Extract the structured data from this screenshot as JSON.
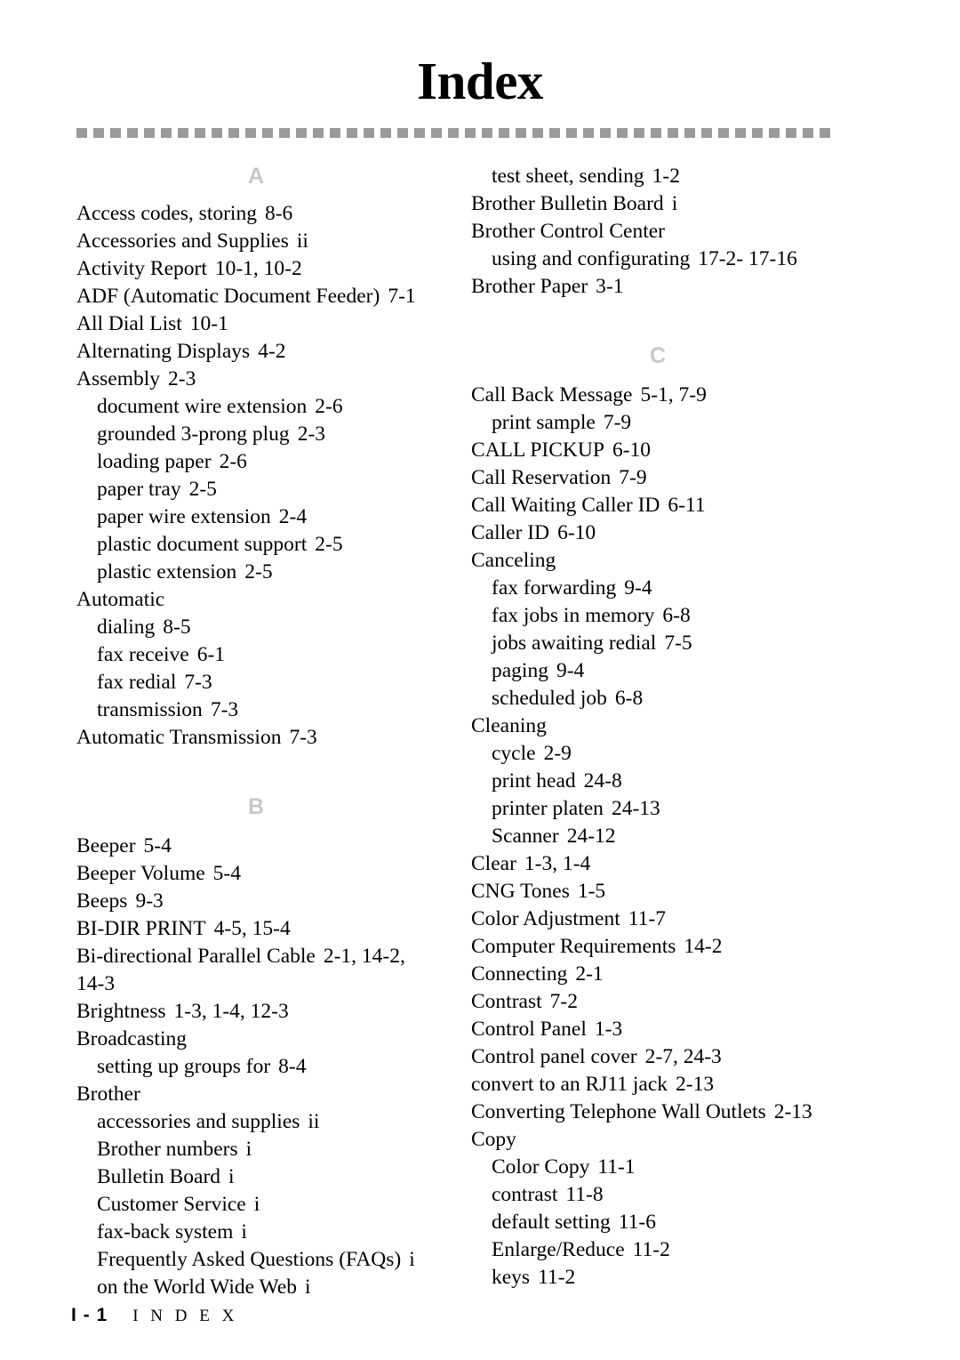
{
  "page": {
    "title": "Index",
    "footer_folio": "I - 1",
    "footer_label": "I N D E X",
    "rule_color": "#9a9a9a",
    "section_letter_color": "#c8c8c8"
  },
  "left_column": {
    "sections": [
      {
        "letter": "A",
        "entries": [
          {
            "term": "Access codes, storing",
            "refs": "8-6",
            "sub": false
          },
          {
            "term": "Accessories and Supplies",
            "refs": "ii",
            "sub": false
          },
          {
            "term": "Activity Report",
            "refs": "10-1,  10-2",
            "sub": false
          },
          {
            "term": "ADF (Automatic Document Feeder)",
            "refs": "7-1",
            "sub": false
          },
          {
            "term": "All Dial List",
            "refs": "10-1",
            "sub": false
          },
          {
            "term": "Alternating Displays",
            "refs": "4-2",
            "sub": false
          },
          {
            "term": "Assembly",
            "refs": "2-3",
            "sub": false
          },
          {
            "term": "document wire extension",
            "refs": "2-6",
            "sub": true
          },
          {
            "term": "grounded 3-prong plug",
            "refs": "2-3",
            "sub": true
          },
          {
            "term": "loading paper",
            "refs": "2-6",
            "sub": true
          },
          {
            "term": "paper tray",
            "refs": "2-5",
            "sub": true
          },
          {
            "term": "paper wire extension",
            "refs": "2-4",
            "sub": true
          },
          {
            "term": "plastic document support",
            "refs": "2-5",
            "sub": true
          },
          {
            "term": "plastic extension",
            "refs": "2-5",
            "sub": true
          },
          {
            "term": "Automatic",
            "refs": "",
            "sub": false
          },
          {
            "term": "dialing",
            "refs": "8-5",
            "sub": true
          },
          {
            "term": "fax receive",
            "refs": "6-1",
            "sub": true
          },
          {
            "term": "fax redial",
            "refs": "7-3",
            "sub": true
          },
          {
            "term": "transmission",
            "refs": "7-3",
            "sub": true
          },
          {
            "term": "Automatic Transmission",
            "refs": "7-3",
            "sub": false
          }
        ]
      },
      {
        "letter": "B",
        "entries": [
          {
            "term": "Beeper",
            "refs": "5-4",
            "sub": false
          },
          {
            "term": "Beeper Volume",
            "refs": "5-4",
            "sub": false
          },
          {
            "term": "Beeps",
            "refs": "9-3",
            "sub": false
          },
          {
            "term": "BI-DIR PRINT",
            "refs": "4-5,  15-4",
            "sub": false
          },
          {
            "term": "Bi-directional Parallel Cable",
            "refs": "2-1,   14-2,  14-3",
            "sub": false,
            "wrap": true
          },
          {
            "term": "Brightness",
            "refs": "1-3,  1-4,  12-3",
            "sub": false
          },
          {
            "term": "Broadcasting",
            "refs": "",
            "sub": false
          },
          {
            "term": "setting up groups for",
            "refs": "8-4",
            "sub": true
          },
          {
            "term": "Brother",
            "refs": "",
            "sub": false
          },
          {
            "term": "accessories and supplies",
            "refs": "ii",
            "sub": true
          },
          {
            "term": "Brother numbers",
            "refs": "i",
            "sub": true
          },
          {
            "term": "Bulletin Board",
            "refs": "i",
            "sub": true
          },
          {
            "term": "Customer Service",
            "refs": "i",
            "sub": true
          },
          {
            "term": "fax-back system",
            "refs": "i",
            "sub": true
          },
          {
            "term": "Frequently Asked Questions (FAQs)",
            "refs": "i",
            "sub": true
          },
          {
            "term": "on the World Wide Web",
            "refs": "i",
            "sub": true
          }
        ]
      }
    ]
  },
  "right_column": {
    "sections": [
      {
        "letter": "",
        "entries": [
          {
            "term": "test sheet, sending",
            "refs": "1-2",
            "sub": true
          },
          {
            "term": "Brother Bulletin Board",
            "refs": "i",
            "sub": false
          },
          {
            "term": "Brother Control Center",
            "refs": "",
            "sub": false
          },
          {
            "term": "using and configurating",
            "refs": "17-2-  17-16",
            "sub": true
          },
          {
            "term": "Brother Paper",
            "refs": "3-1",
            "sub": false
          }
        ]
      },
      {
        "letter": "C",
        "entries": [
          {
            "term": "Call Back Message",
            "refs": "5-1,  7-9",
            "sub": false
          },
          {
            "term": "print sample",
            "refs": "7-9",
            "sub": true
          },
          {
            "term": "CALL PICKUP",
            "refs": "6-10",
            "sub": false
          },
          {
            "term": "Call Reservation",
            "refs": "7-9",
            "sub": false
          },
          {
            "term": "Call Waiting Caller ID",
            "refs": "6-11",
            "sub": false
          },
          {
            "term": "Caller ID",
            "refs": "6-10",
            "sub": false
          },
          {
            "term": "Canceling",
            "refs": "",
            "sub": false
          },
          {
            "term": "fax forwarding",
            "refs": "9-4",
            "sub": true
          },
          {
            "term": "fax jobs in memory",
            "refs": "6-8",
            "sub": true
          },
          {
            "term": "jobs awaiting redial",
            "refs": "7-5",
            "sub": true
          },
          {
            "term": "paging",
            "refs": "9-4",
            "sub": true
          },
          {
            "term": "scheduled job",
            "refs": "6-8",
            "sub": true
          },
          {
            "term": "Cleaning",
            "refs": "",
            "sub": false
          },
          {
            "term": "cycle",
            "refs": "2-9",
            "sub": true
          },
          {
            "term": "print head",
            "refs": "24-8",
            "sub": true
          },
          {
            "term": "printer platen",
            "refs": "24-13",
            "sub": true
          },
          {
            "term": "Scanner",
            "refs": "24-12",
            "sub": true
          },
          {
            "term": "Clear",
            "refs": "1-3,  1-4",
            "sub": false
          },
          {
            "term": "CNG Tones",
            "refs": "1-5",
            "sub": false
          },
          {
            "term": "Color Adjustment",
            "refs": "11-7",
            "sub": false
          },
          {
            "term": "Computer Requirements",
            "refs": "14-2",
            "sub": false
          },
          {
            "term": "Connecting",
            "refs": "2-1",
            "sub": false
          },
          {
            "term": "Contrast",
            "refs": "7-2",
            "sub": false
          },
          {
            "term": "Control Panel",
            "refs": "1-3",
            "sub": false
          },
          {
            "term": "Control panel cover",
            "refs": "2-7,  24-3",
            "sub": false
          },
          {
            "term": "convert to an RJ11 jack",
            "refs": "2-13",
            "sub": false
          },
          {
            "term": "Converting Telephone Wall Outlets",
            "refs": "2-13",
            "sub": false
          },
          {
            "term": "Copy",
            "refs": "",
            "sub": false
          },
          {
            "term": "Color Copy",
            "refs": "11-1",
            "sub": true
          },
          {
            "term": "contrast",
            "refs": "11-8",
            "sub": true
          },
          {
            "term": "default setting",
            "refs": "11-6",
            "sub": true
          },
          {
            "term": "Enlarge/Reduce",
            "refs": "11-2",
            "sub": true
          },
          {
            "term": "keys",
            "refs": "11-2",
            "sub": true
          }
        ]
      }
    ]
  }
}
